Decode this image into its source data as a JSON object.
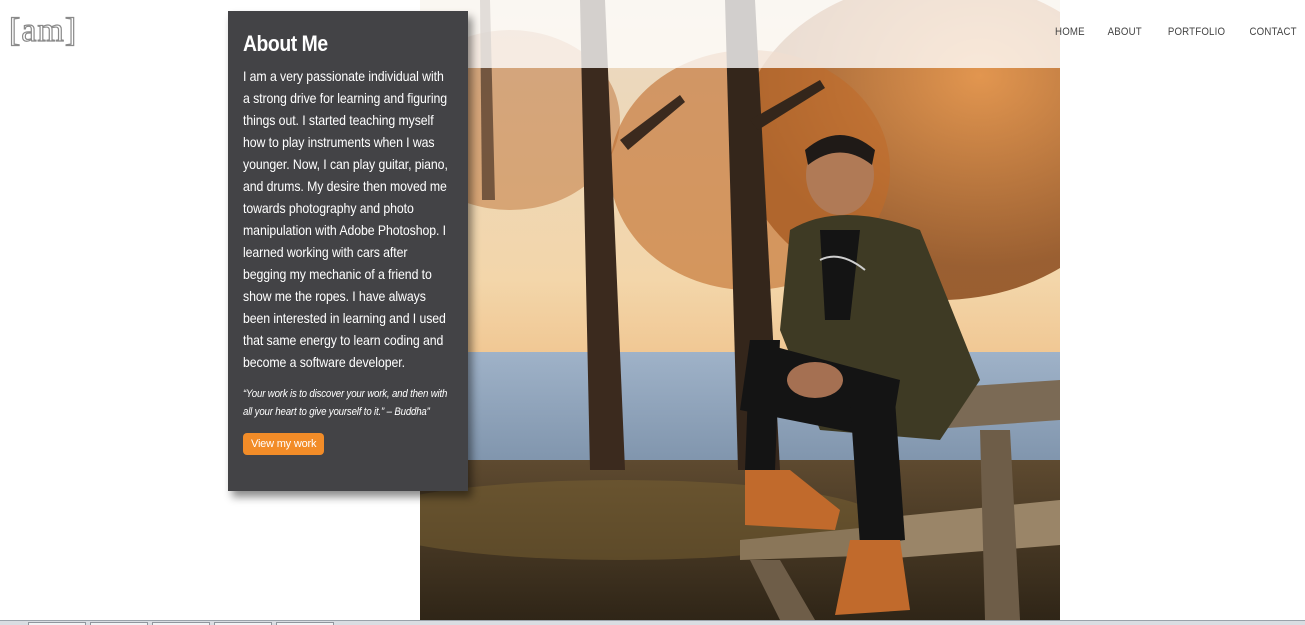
{
  "logo": {
    "text": "[am]"
  },
  "nav": {
    "items": [
      {
        "label": "HOME"
      },
      {
        "label": "ABOUT"
      },
      {
        "label": "PORTFOLIO"
      },
      {
        "label": "CONTACT"
      }
    ]
  },
  "about": {
    "title": "About Me",
    "bio": "I am a very passionate individual with a strong drive for learning and figuring things out. I started teaching myself how to play instruments when I was younger. Now, I can play guitar, piano, and drums. My desire then moved me towards photography and photo manipulation with Adobe Photoshop. I learned working with cars after begging my mechanic of a friend to show me the ropes. I have always been interested in learning and I used that same energy to learn coding and become a software developer.",
    "quote": "“Your work is to discover your work, and then with all your heart to give yourself to it.” – Buddha”",
    "button_label": "View my work"
  },
  "colors": {
    "card_bg": "#434346",
    "button": "#f28c28",
    "nav_text": "#444444"
  }
}
